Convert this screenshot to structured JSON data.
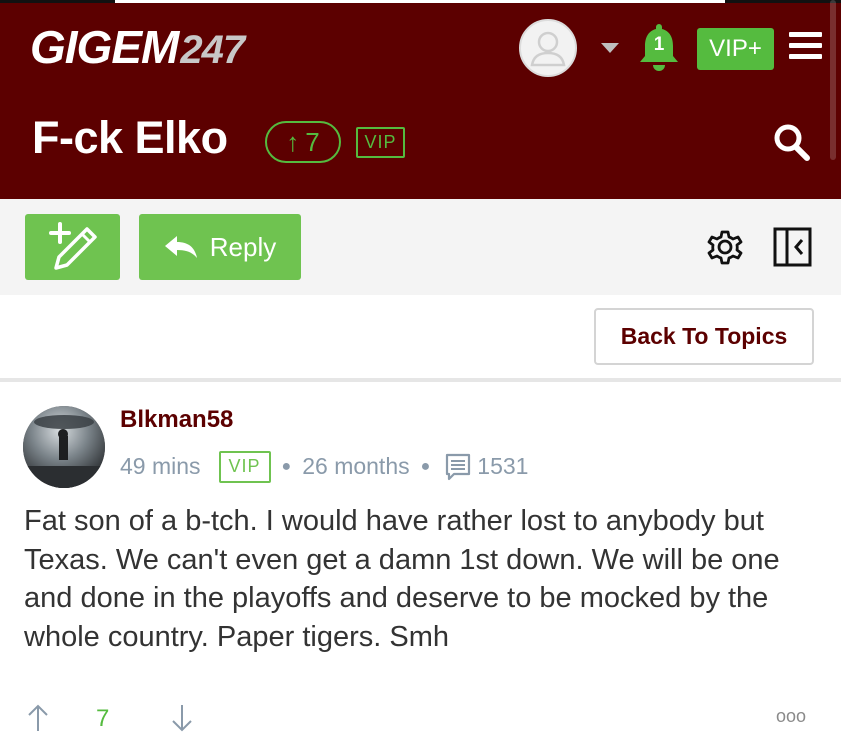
{
  "header": {
    "logo_main": "GIGEM",
    "logo_suffix": "247",
    "notification_count": "1",
    "vip_plus_label": "VIP+",
    "thread_title": "F-ck Elko",
    "thread_upvotes": "7",
    "thread_badge": "VIP",
    "upvote_arrow": "↑"
  },
  "toolbar": {
    "reply_label": "Reply"
  },
  "nav": {
    "back_to_topics_label": "Back To Topics"
  },
  "post": {
    "username": "Blkman58",
    "time_ago": "49 mins",
    "badge": "VIP",
    "member_duration": "26 months",
    "post_count": "1531",
    "body": "Fat son of a b-tch. I would have rather lost to anybody but Texas. We can't even get a damn 1st down. We will be one and done in the playoffs and deserve to be mocked by the whole country. Paper tigers. Smh",
    "vote_count": "7",
    "more_label": "ooo"
  },
  "colors": {
    "brand_maroon": "#5c0000",
    "accent_green": "#55bb3f",
    "button_green": "#6fc350",
    "meta_gray": "#8a9aaa"
  },
  "icons": {
    "avatar": "user-silhouette-icon",
    "dropdown": "caret-down-icon",
    "notifications": "bell-icon",
    "menu": "hamburger-icon",
    "search": "search-icon",
    "new_post": "pencil-plus-icon",
    "reply": "reply-arrow-icon",
    "settings": "gear-icon",
    "collapse": "collapse-panel-icon",
    "post_count": "message-icon",
    "upvote": "arrow-up-icon",
    "downvote": "arrow-down-icon"
  }
}
